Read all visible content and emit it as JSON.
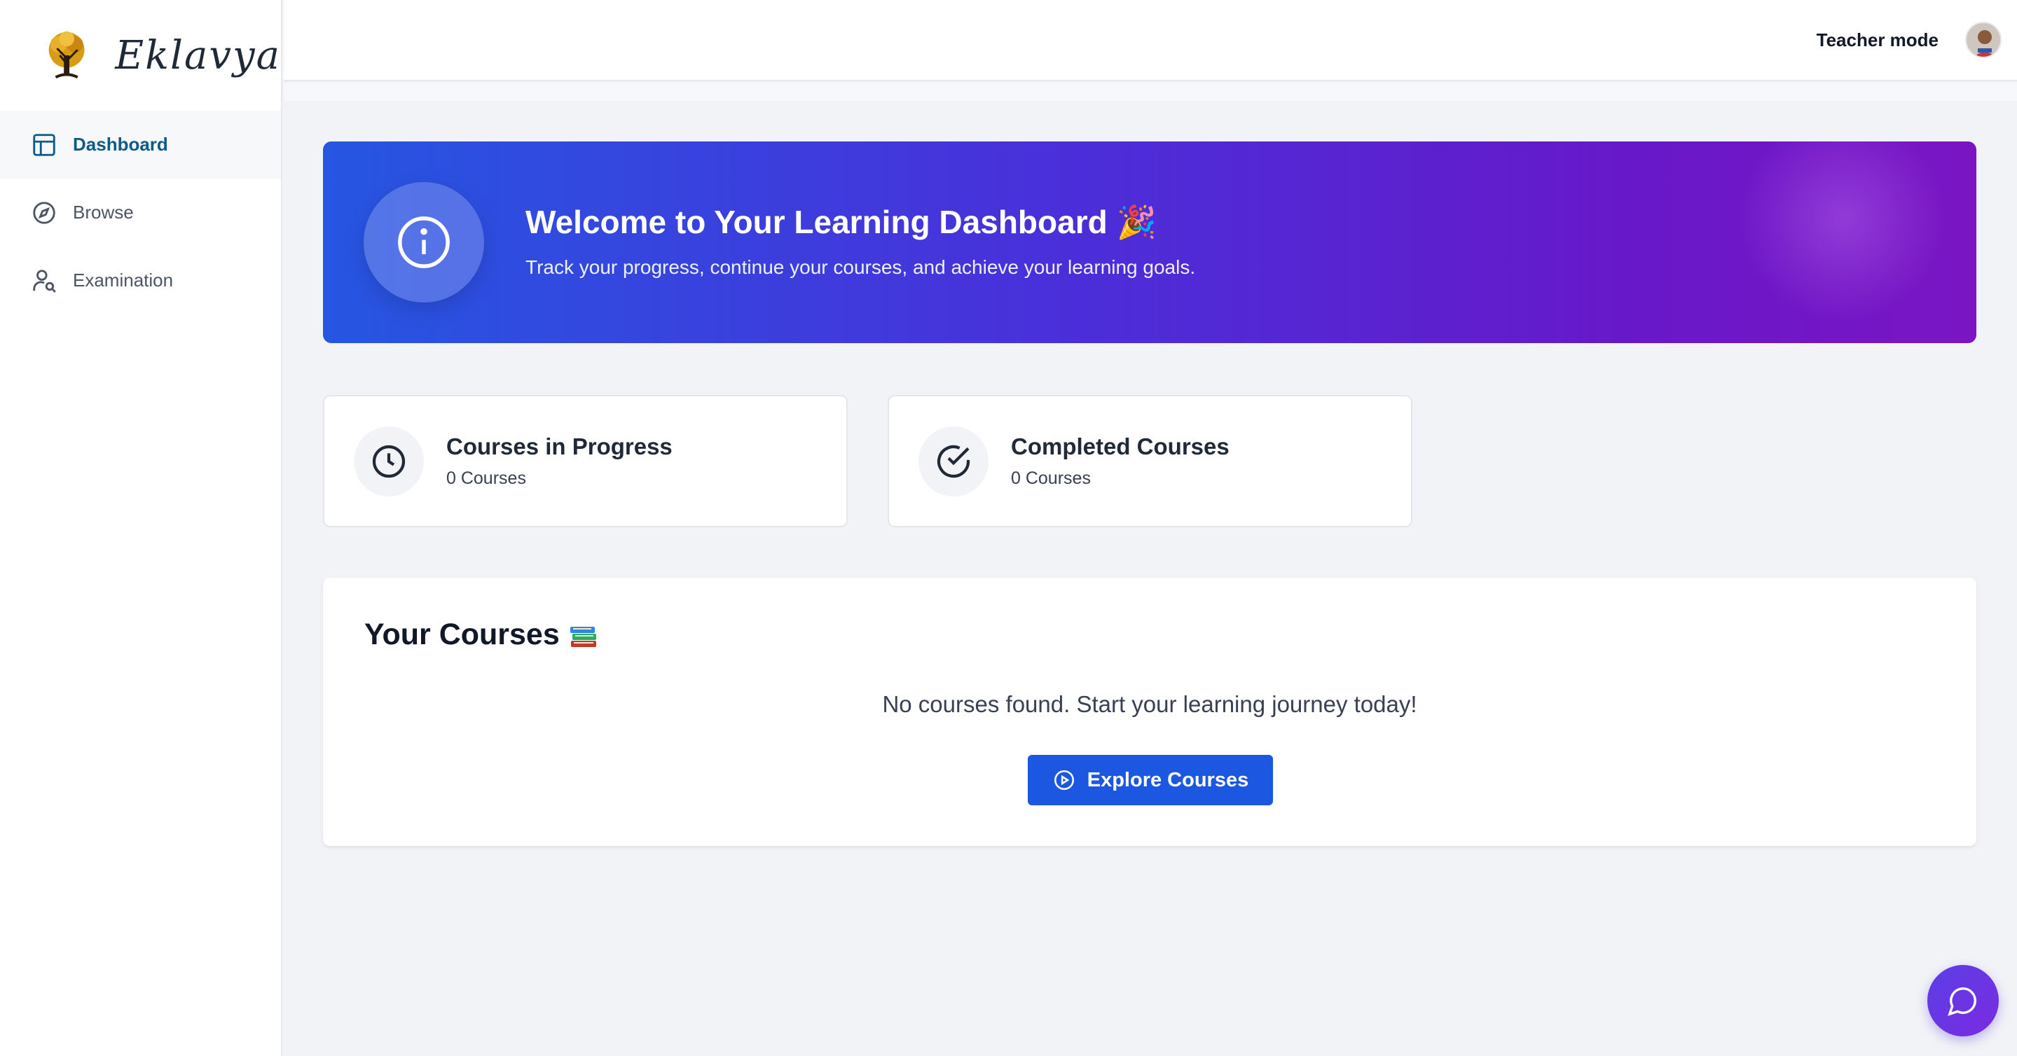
{
  "app": {
    "name": "Eklavya"
  },
  "sidebar": {
    "items": [
      {
        "label": "Dashboard",
        "icon": "layout-icon",
        "active": true
      },
      {
        "label": "Browse",
        "icon": "compass-icon",
        "active": false
      },
      {
        "label": "Examination",
        "icon": "user-search-icon",
        "active": false
      }
    ]
  },
  "topbar": {
    "mode_label": "Teacher mode",
    "avatar": "user-avatar"
  },
  "banner": {
    "title": "Welcome to Your Learning Dashboard 🎉",
    "subtitle": "Track your progress, continue your courses, and achieve your learning goals.",
    "icon": "info-icon"
  },
  "stats": [
    {
      "title": "Courses in Progress",
      "count": "0 Courses",
      "icon": "clock-icon"
    },
    {
      "title": "Completed Courses",
      "count": "0 Courses",
      "icon": "check-circle-icon"
    }
  ],
  "courses": {
    "title": "Your Courses",
    "icon": "books-icon",
    "empty_message": "No courses found. Start your learning journey today!",
    "explore_label": "Explore Courses"
  },
  "chat": {
    "icon": "chat-bubble-icon"
  },
  "colors": {
    "primary": "#1b57e0",
    "active_nav": "#0b5a8a",
    "banner_start": "#2656e2",
    "banner_end": "#7a15c3",
    "chat": "#5b3fe6"
  }
}
